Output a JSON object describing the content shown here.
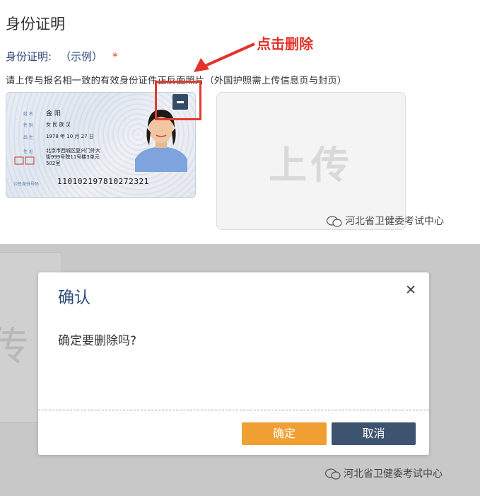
{
  "section": {
    "title": "身份证明"
  },
  "field": {
    "label": "身份证明:",
    "example": "（示例）",
    "required_mark": "*"
  },
  "instructions": "请上传与报名相一致的有效身份证件正反面照片（外国护照需上传信息页与封页）",
  "annotation": {
    "text": "点击删除",
    "color": "#e2332a"
  },
  "id_card": {
    "fields": [
      {
        "label": "姓 名",
        "value": "金 阳"
      },
      {
        "label": "性 别",
        "value": "女    民 族 汉"
      },
      {
        "label": "出 生",
        "value": "1978  年 10 月 27 日"
      },
      {
        "label": "住 址",
        "value": "北京市西城区复兴门外大"
      },
      {
        "label": "",
        "value": "街999号院11号楼3单元"
      },
      {
        "label": "",
        "value": "502室"
      }
    ],
    "number_label": "公民身份号码",
    "number": "110102197810272321"
  },
  "remove_button": {
    "icon": "minus-icon"
  },
  "upload": {
    "label": "上传"
  },
  "watermark": {
    "text": "河北省卫健委考试中心",
    "icon": "wechat-icon"
  },
  "background": {
    "partial_char": "传"
  },
  "dialog": {
    "title": "确认",
    "close_icon": "close-icon",
    "close_glyph": "✕",
    "message": "确定要删除吗?",
    "ok_label": "确定",
    "cancel_label": "取消"
  },
  "colors": {
    "accent_blue": "#2f4b79",
    "ok_orange": "#f0a033",
    "cancel_navy": "#3e536f",
    "highlight_red": "#e13b2e"
  }
}
